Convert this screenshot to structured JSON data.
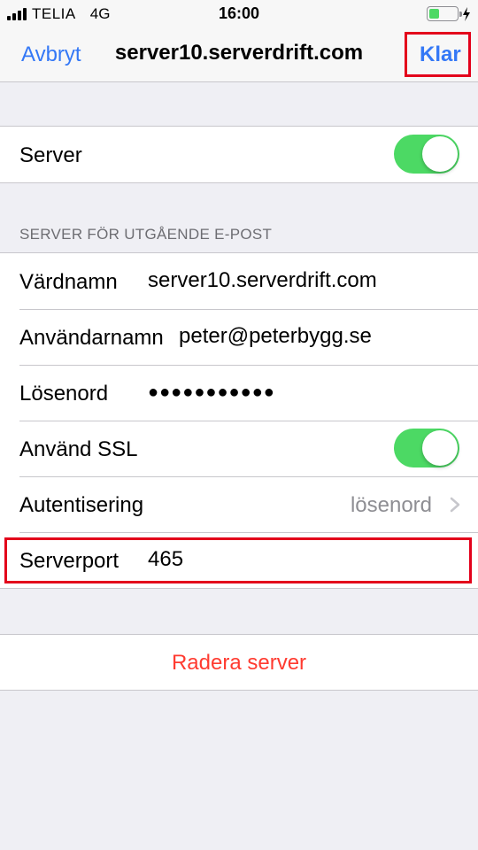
{
  "status_bar": {
    "carrier": "TELIA",
    "network": "4G",
    "time": "16:00",
    "battery_level": 0.35,
    "charging_icon": "bolt-icon"
  },
  "nav": {
    "cancel_label": "Avbryt",
    "title": "server10.serverdrift.com",
    "done_label": "Klar"
  },
  "server_toggle": {
    "label": "Server",
    "on": true
  },
  "outgoing": {
    "header": "SERVER FÖR UTGÅENDE E-POST",
    "hostname_label": "Värdnamn",
    "hostname_value": "server10.serverdrift.com",
    "username_label": "Användarnamn",
    "username_value": "peter@peterbygg.se",
    "password_label": "Lösenord",
    "password_value": "●●●●●●●●●●●",
    "ssl_label": "Använd SSL",
    "ssl_on": true,
    "auth_label": "Autentisering",
    "auth_value": "lösenord",
    "port_label": "Serverport",
    "port_value": "465"
  },
  "delete": {
    "label": "Radera server"
  },
  "colors": {
    "accent": "#3478f6",
    "toggle_on": "#4cd964",
    "destructive": "#ff3b30",
    "highlight_box": "#e3001b"
  }
}
